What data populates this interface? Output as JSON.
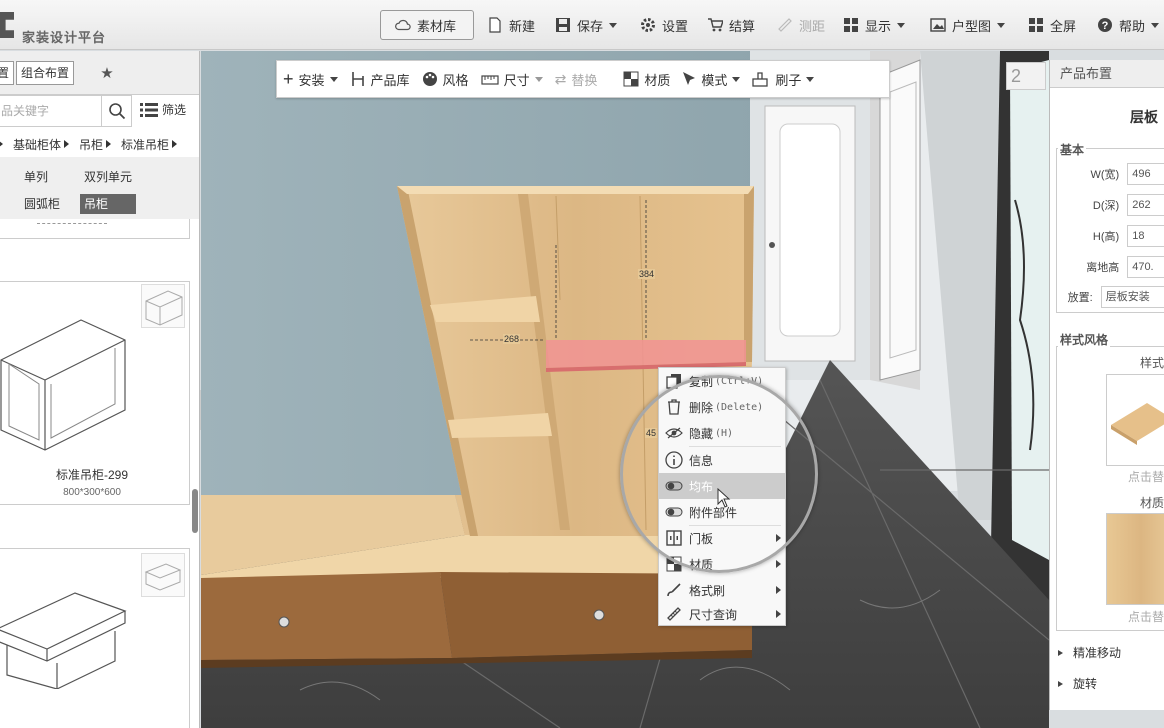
{
  "app": {
    "title": "家装设计平台"
  },
  "topbar": {
    "material_lib": "素材库",
    "new": "新建",
    "save": "保存",
    "settings": "设置",
    "checkout": "结算",
    "measure": "测距",
    "display": "显示",
    "floorplan": "户型图",
    "fullscreen": "全屏",
    "help": "帮助"
  },
  "left_panel": {
    "tabs": [
      "置",
      "组合布置"
    ],
    "search_placeholder": "品关键字",
    "filter": "筛选",
    "breadcrumb": [
      "基础柜体",
      "吊柜",
      "标准吊柜"
    ],
    "categories": [
      "单列",
      "双列单元",
      "圆弧柜",
      "吊柜"
    ],
    "active_category": "吊柜",
    "products": [
      {
        "name": "标准吊柜-299",
        "size": "800*300*600"
      },
      {
        "name": "",
        "size": ""
      }
    ]
  },
  "float_toolbar": {
    "install": "安装",
    "product_lib": "产品库",
    "style": "风格",
    "size": "尺寸",
    "replace": "替换",
    "material": "材质",
    "mode": "模式",
    "brush": "刷子"
  },
  "scene": {
    "dims": [
      "384",
      "268",
      "45"
    ]
  },
  "context_menu": {
    "items": [
      {
        "label": "复制",
        "shortcut": "(Ctrl+V)"
      },
      {
        "label": "删除",
        "shortcut": "(Delete)"
      },
      {
        "label": "隐藏",
        "shortcut": "(H)"
      },
      {
        "label": "信息",
        "shortcut": ""
      },
      {
        "label": "均布",
        "shortcut": ""
      },
      {
        "label": "附件部件",
        "shortcut": ""
      },
      {
        "label": "门板",
        "shortcut": ""
      },
      {
        "label": "材质",
        "shortcut": ""
      },
      {
        "label": "格式刷",
        "shortcut": ""
      },
      {
        "label": "尺寸查询",
        "shortcut": ""
      }
    ]
  },
  "right_panel": {
    "header": "产品布置",
    "product_name": "层板",
    "basic": {
      "title": "基本",
      "width_label": "W(宽)",
      "width": "496",
      "depth_label": "D(深)",
      "depth": "262",
      "height_label": "H(高)",
      "height": "18",
      "ground_label": "离地高",
      "ground": "470.",
      "place_label": "放置:",
      "place": "层板安装"
    },
    "style": {
      "title": "样式风格",
      "style_label": "样式",
      "click_replace": "点击替",
      "material_label": "材质",
      "click_replace2": "点击替"
    },
    "precise_move": "精准移动",
    "rotate": "旋转",
    "corner_badge": "2"
  }
}
